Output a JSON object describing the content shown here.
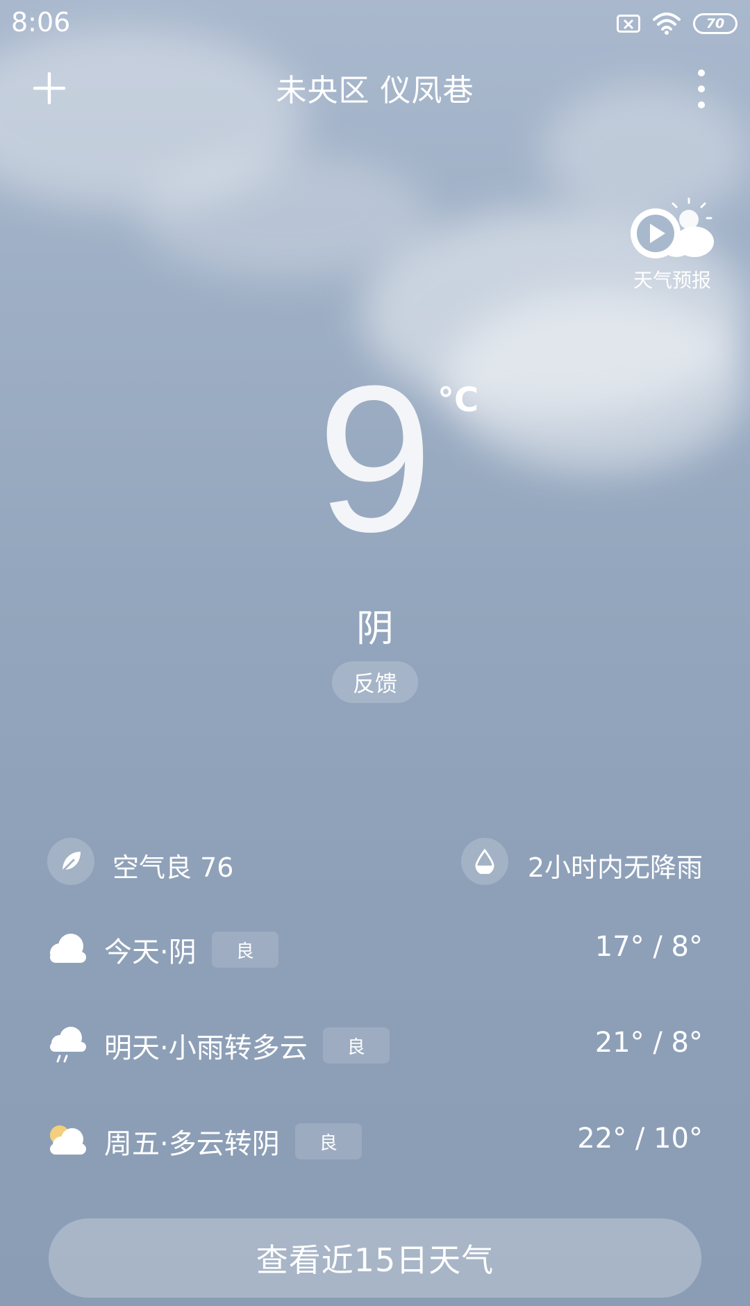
{
  "status_bar": {
    "time": "8:06",
    "battery": "70"
  },
  "header": {
    "title": "未央区 仪凤巷"
  },
  "forecast_video": {
    "label": "天气预报"
  },
  "current": {
    "temperature": "9",
    "unit": "°C",
    "condition": "阴",
    "feedback_label": "反馈"
  },
  "info": {
    "air_quality": "空气良 76",
    "precipitation": "2小时内无降雨"
  },
  "forecast": [
    {
      "day_condition": "今天·阴",
      "aqi_badge": "良",
      "temps": "17° / 8°",
      "icon": "cloudy-icon"
    },
    {
      "day_condition": "明天·小雨转多云",
      "aqi_badge": "良",
      "temps": "21° / 8°",
      "icon": "light-rain-icon"
    },
    {
      "day_condition": "周五·多云转阴",
      "aqi_badge": "良",
      "temps": "22° / 10°",
      "icon": "partly-cloudy-icon"
    }
  ],
  "button_15day": "查看近15日天气",
  "colors": {
    "background": "#94a6bd",
    "text": "#ffffff",
    "sun": "#f3cf7d"
  }
}
